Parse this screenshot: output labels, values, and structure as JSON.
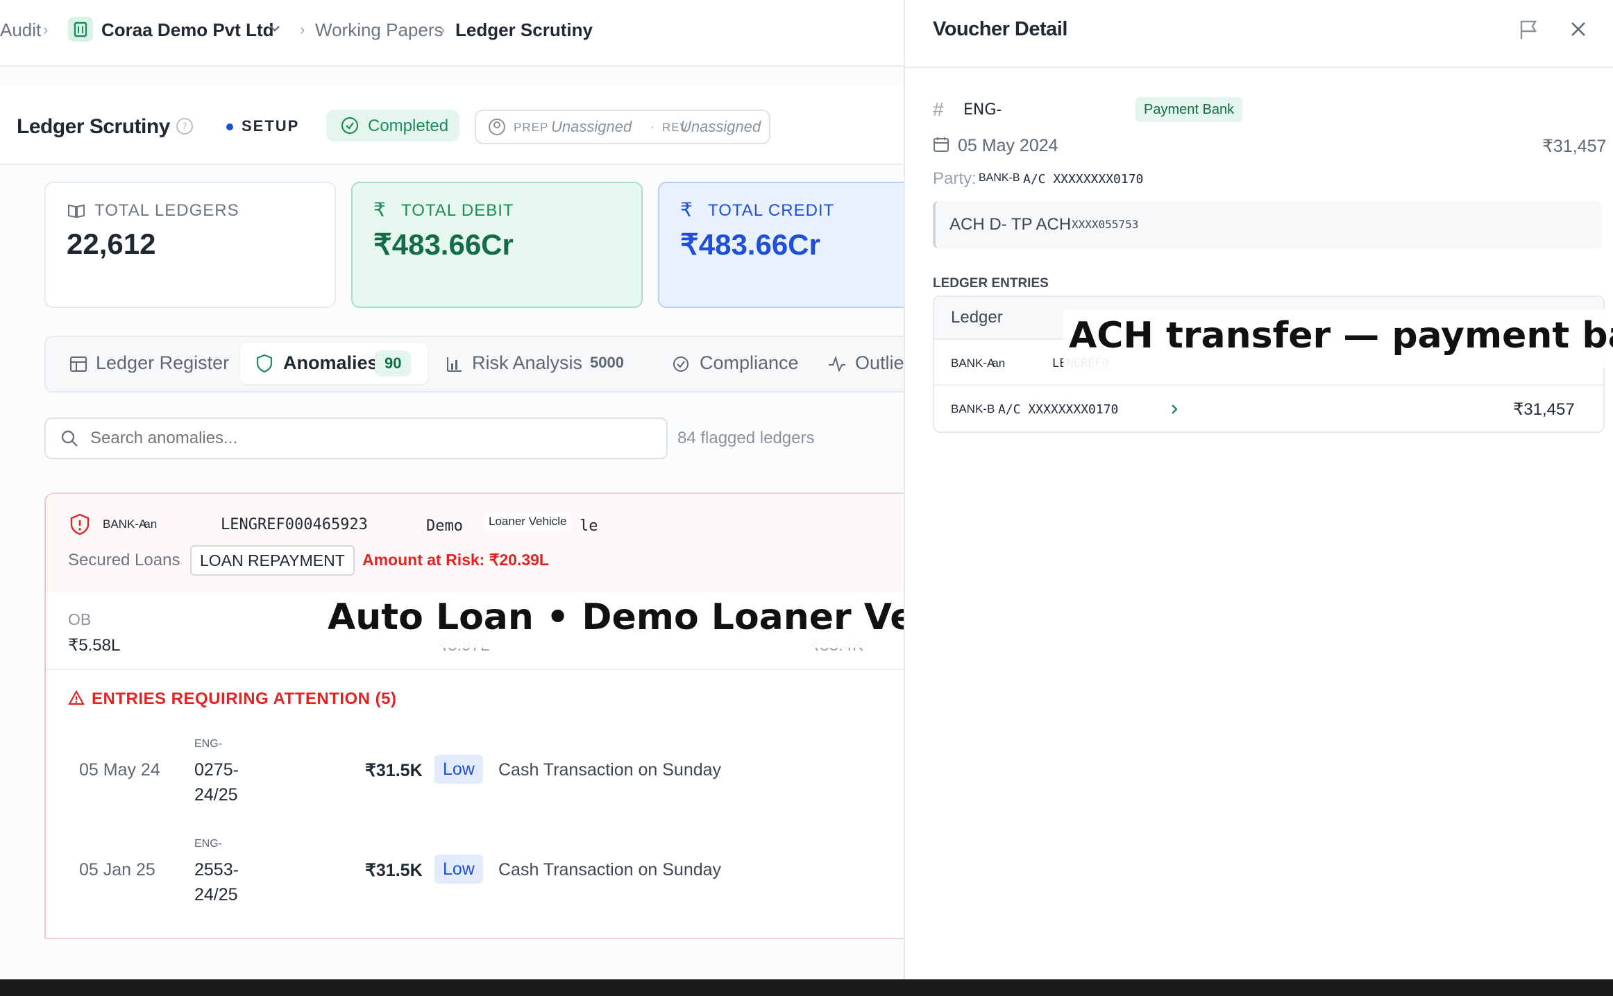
{
  "breadcrumb": {
    "audit": "Audit",
    "org": "Coraa Demo Pvt Ltd",
    "working_papers": "Working Papers",
    "current": "Ledger Scrutiny"
  },
  "header": {
    "title": "Ledger Scrutiny",
    "stage": "SETUP",
    "status": "Completed",
    "prep_label": "PREP",
    "prep_value": "Unassigned",
    "rev_label": "REV",
    "rev_value": "Unassigned"
  },
  "stats": {
    "total_ledgers": {
      "label": "TOTAL LEDGERS",
      "value": "22,612"
    },
    "total_debit": {
      "label": "TOTAL DEBIT",
      "value": "₹483.66Cr"
    },
    "total_credit": {
      "label": "TOTAL CREDIT",
      "value": "₹483.66Cr"
    }
  },
  "tabs": [
    {
      "label": "Ledger Register",
      "badge": ""
    },
    {
      "label": "Anomalies",
      "badge": "90"
    },
    {
      "label": "Risk Analysis",
      "badge": "5000"
    },
    {
      "label": "Compliance",
      "badge": ""
    },
    {
      "label": "Outlier",
      "badge": ""
    }
  ],
  "search": {
    "placeholder": "Search anomalies...",
    "count": "84 flagged ledgers"
  },
  "anomaly": {
    "bank": "BANK-A",
    "bank_suffix": "an",
    "ledger_ref": "LENGREF000465923",
    "name_prefix": "Demo",
    "name_suffix": "le",
    "name_tooltip": "Loaner Vehicle",
    "group": "Secured Loans",
    "tag": "LOAN REPAYMENT",
    "risk": "Amount at Risk: ₹20.39L",
    "ob_label": "OB",
    "ob_value": "₹5.58L",
    "hidden_val_1": "₹3.97L",
    "hidden_val_2": "₹33.4K",
    "attention_title": "ENTRIES REQUIRING ATTENTION (5)",
    "entries": [
      {
        "date": "05 May 24",
        "voucher_prefix": "ENG-",
        "voucher_line1": "0275-",
        "voucher_line2": "24/25",
        "amount": "₹31.5K",
        "level": "Low",
        "reason": "Cash Transaction on Sunday"
      },
      {
        "date": "05 Jan 25",
        "voucher_prefix": "ENG-",
        "voucher_line1": "2553-",
        "voucher_line2": "24/25",
        "amount": "₹31.5K",
        "level": "Low",
        "reason": "Cash Transaction on Sunday"
      }
    ]
  },
  "drawer": {
    "title": "Voucher Detail",
    "voucher_no": "ENG-",
    "type_badge": "Payment Bank",
    "date": "05 May 2024",
    "amount": "₹31,457",
    "party_label": "Party:",
    "party_bank": "BANK-B",
    "party_ac": "A/C XXXXXXXX0170",
    "narration_main": "ACH D- TP ACH",
    "narration_ref": "XXXX055753",
    "entries_title": "LEDGER ENTRIES",
    "col_ledger": "Ledger",
    "row1_bank": "BANK-A",
    "row1_suffix": "an",
    "row1_ref": "LENGREF0",
    "row2_bank": "BANK-B",
    "row2_ac": "A/C XXXXXXXX0170",
    "row2_amount": "₹31,457"
  },
  "overlays": {
    "caption_left": "Auto Loan • Demo Loaner Vehicle",
    "caption_right": "ACH transfer — payment bar"
  },
  "colors": {
    "green": "#1f8a5b",
    "blue": "#1d4fd8",
    "red": "#e02424",
    "muted": "#6b7682"
  }
}
